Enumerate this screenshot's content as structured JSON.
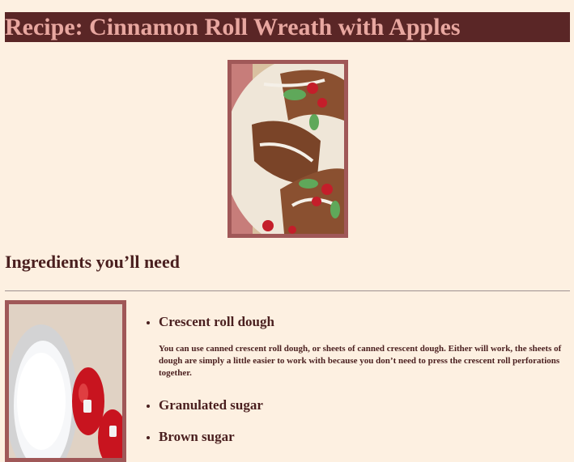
{
  "page": {
    "title": "Recipe: Cinnamon Roll Wreath with Apples"
  },
  "hero_image": {
    "alt": "Cinnamon roll wreath with icing, cranberries and mint"
  },
  "ingredients": {
    "heading": "Ingredients you’ll need",
    "side_image_alt": "Bowl of powdered sugar and red apples",
    "items": [
      {
        "name": "Crescent roll dough",
        "description": "You can use canned crescent roll dough, or sheets of canned crescent dough. Either will work, the sheets of dough are simply a little easier to work with because you don’t need to press the crescent roll perforations together."
      },
      {
        "name": "Granulated sugar",
        "description": ""
      },
      {
        "name": "Brown sugar",
        "description": ""
      }
    ]
  },
  "colors": {
    "background": "#fdf0e1",
    "title_bar": "#5a2626",
    "title_text": "#e8a7a0",
    "image_border": "#a05858",
    "text": "#4a1f1f"
  }
}
